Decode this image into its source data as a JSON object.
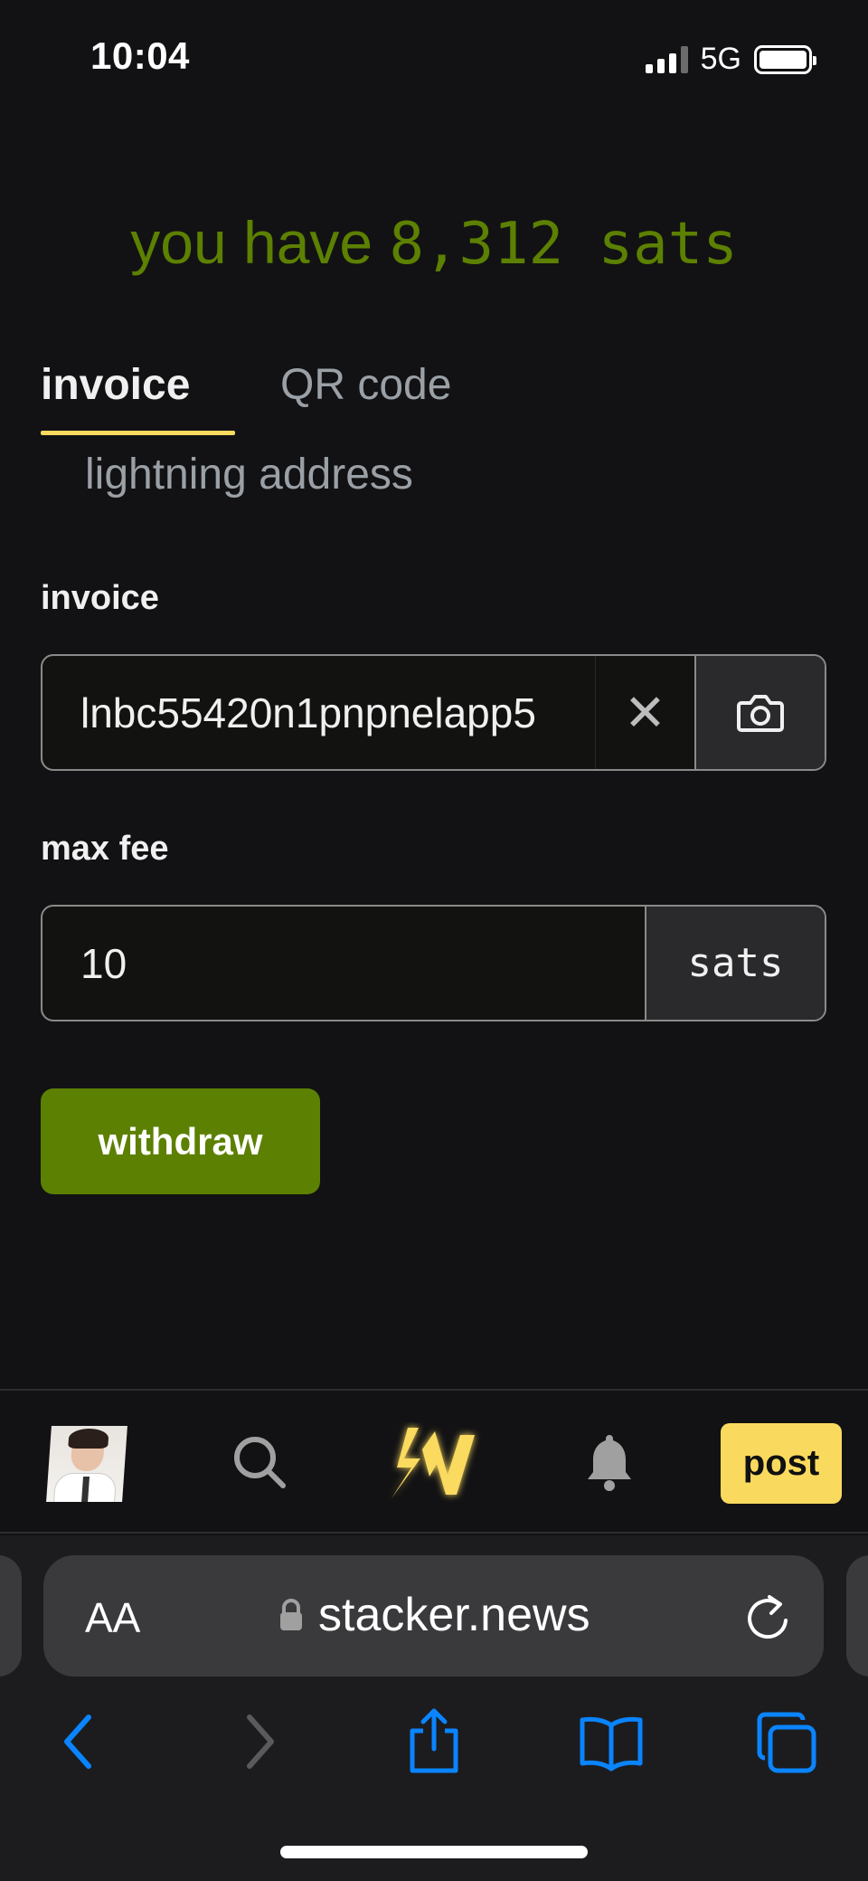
{
  "status_bar": {
    "time": "10:04",
    "network": "5G"
  },
  "balance": {
    "prefix": "you have",
    "amount": "8,312 sats"
  },
  "tabs": [
    {
      "label": "invoice",
      "active": true
    },
    {
      "label": "QR code",
      "active": false
    },
    {
      "label": "lightning address",
      "active": false
    }
  ],
  "form": {
    "invoice_label": "invoice",
    "invoice_value": "lnbc55420n1pnpnelapp5",
    "max_fee_label": "max fee",
    "max_fee_value": "10",
    "max_fee_unit": "sats",
    "withdraw_label": "withdraw"
  },
  "bottom_nav": {
    "post_label": "post"
  },
  "browser": {
    "aa_label": "AA",
    "url": "stacker.news"
  },
  "colors": {
    "accent_green": "#5c8001",
    "brand_yellow": "#fada5e",
    "ios_blue": "#0a84ff"
  },
  "icons": [
    "signal-icon",
    "battery-icon",
    "close-icon",
    "camera-icon",
    "search-icon",
    "stacker-news-logo",
    "bell-icon",
    "lock-icon",
    "reload-icon",
    "back-icon",
    "forward-icon",
    "share-icon",
    "bookmarks-icon",
    "tabs-icon"
  ]
}
